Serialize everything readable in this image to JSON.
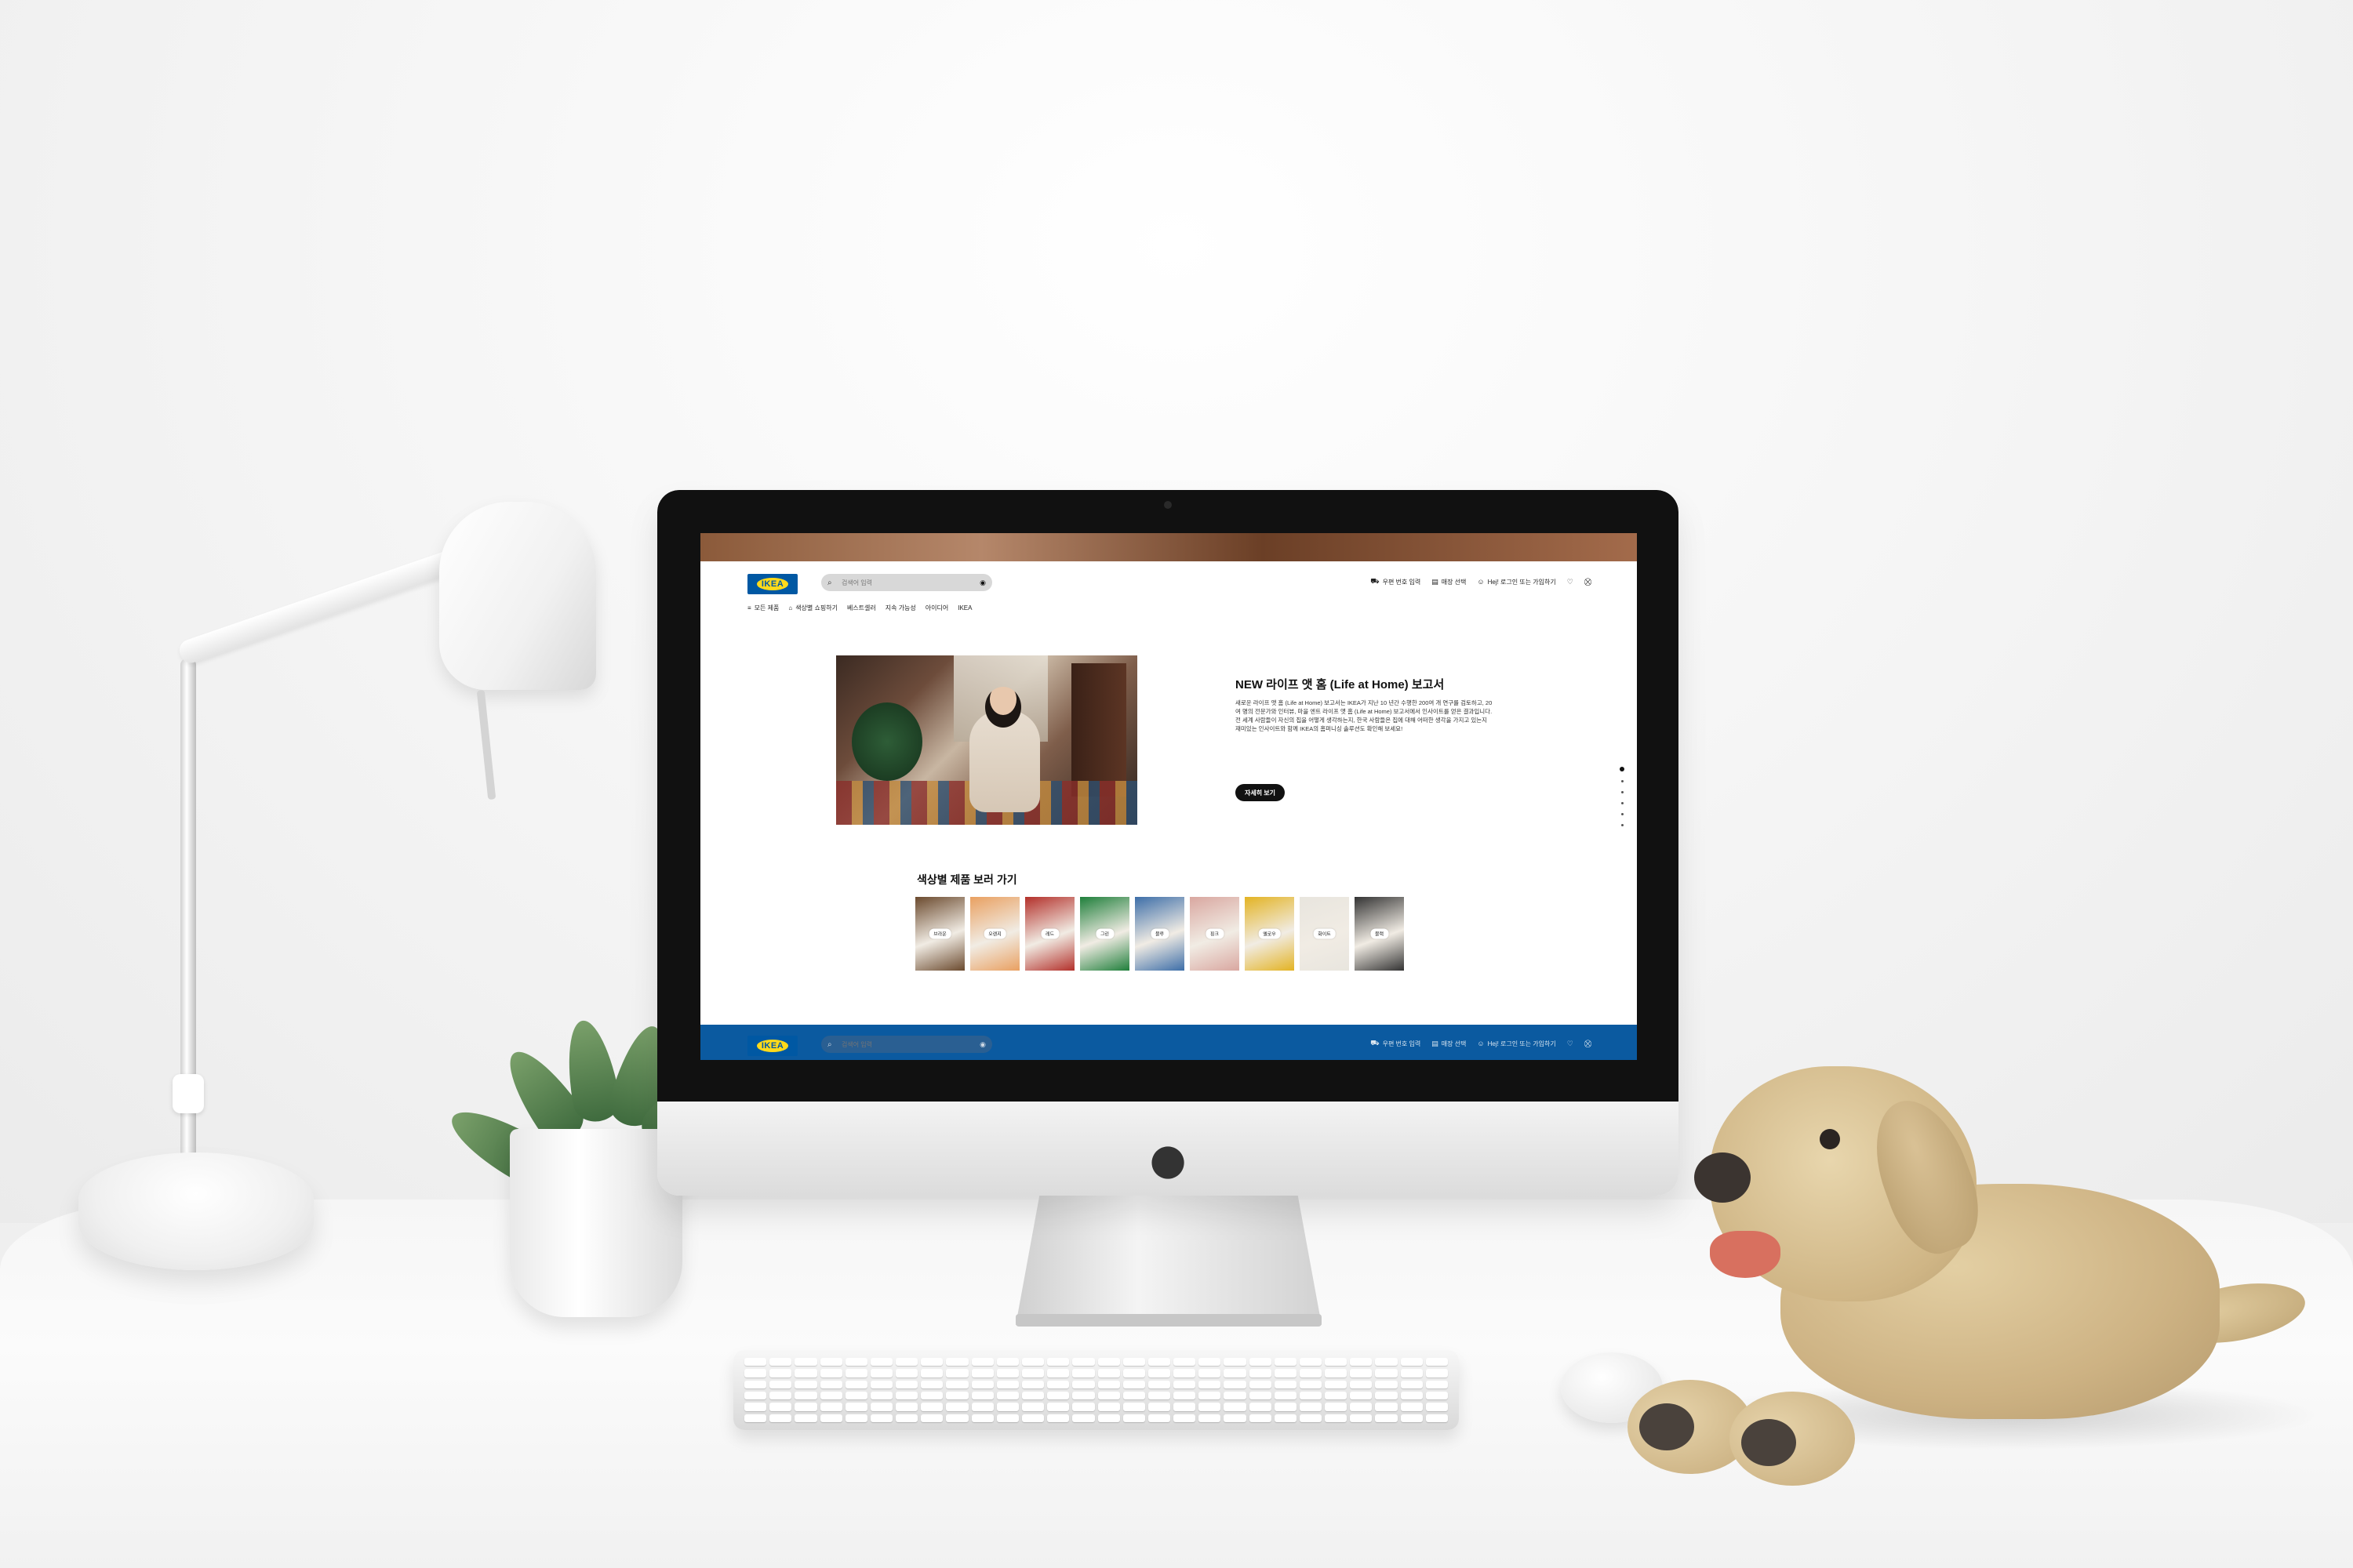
{
  "site": {
    "brand": "IKEA",
    "brand_colors": {
      "blue": "#0058a3",
      "yellow": "#ffda1a",
      "footer_blue": "#0b5aa0"
    }
  },
  "header": {
    "search_placeholder": "검색어 입력",
    "utility": [
      {
        "icon": "truck-icon",
        "label": "우편 번호 입력"
      },
      {
        "icon": "store-icon",
        "label": "매장 선택"
      },
      {
        "icon": "user-icon",
        "label": "Hej! 로그인 또는 가입하기"
      }
    ],
    "nav": [
      {
        "icon": "list-icon",
        "label": "모든 제품"
      },
      {
        "icon": "home-icon",
        "label": "색상별 쇼핑하기"
      },
      {
        "label": "베스트셀러"
      },
      {
        "label": "지속 가능성"
      },
      {
        "label": "아이디어"
      },
      {
        "label": "IKEA"
      }
    ]
  },
  "hero": {
    "title": "NEW 라이프 앳 홈 (Life at Home) 보고서",
    "body": "새로운 라이프 앳 홈 (Life at Home) 보고서는 IKEA가 지난 10 년간 수행한 200여 개 연구를 검토하고, 20여 명의 전문가와 인터뷰, 마을 엔트 라이프 앳 홈 (Life at Home) 보고서에서 인사이트를 얻은 결과입니다. 전 세계 사람들이 자신의 집을 어떻게 생각하는지, 한국 사람들은 집에 대해 어떠한 생각을 가지고 있는지 재미있는 인사이트와 함께 IKEA의 홈퍼니싱 솔루션도 확인해 보세요!",
    "button_label": "자세히 보기",
    "slide_count": 6,
    "active_slide": 1
  },
  "color_section": {
    "title": "색상별 제품 보러 가기",
    "swatches": [
      {
        "label": "브라운",
        "color": "#6b4a2e"
      },
      {
        "label": "오렌지",
        "color": "#e9a061"
      },
      {
        "label": "레드",
        "color": "#b3302a"
      },
      {
        "label": "그린",
        "color": "#1f7f3b"
      },
      {
        "label": "블루",
        "color": "#3d6ea8"
      },
      {
        "label": "핑크",
        "color": "#d9a7a0"
      },
      {
        "label": "옐로우",
        "color": "#e3b323"
      },
      {
        "label": "화이트",
        "color": "#e8e5de"
      },
      {
        "label": "블랙",
        "color": "#333333"
      }
    ]
  }
}
